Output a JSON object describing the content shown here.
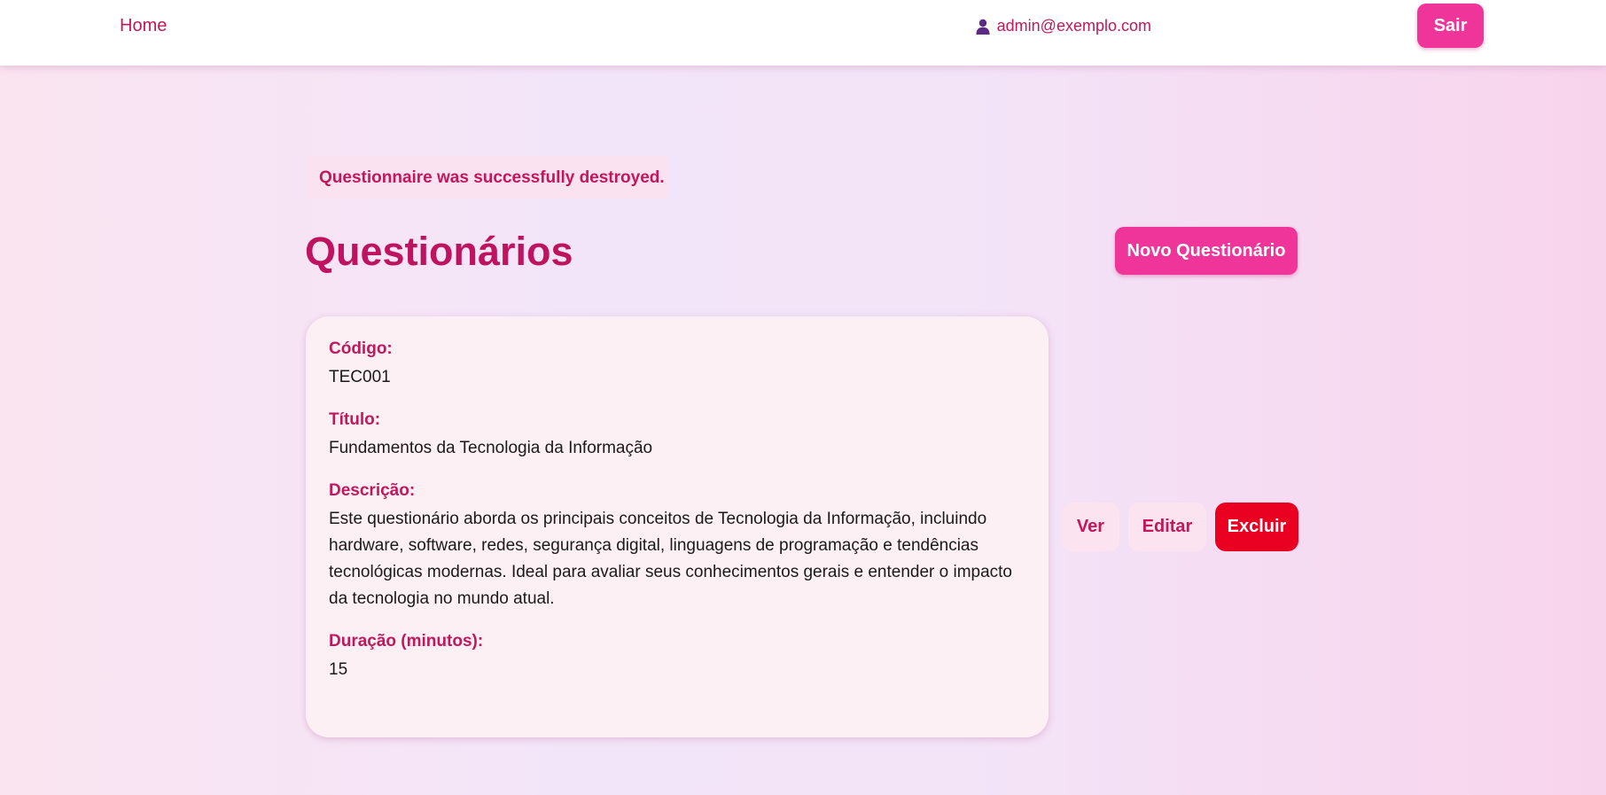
{
  "nav": {
    "home_label": "Home",
    "user_email": "admin@exemplo.com",
    "logout_label": "Sair"
  },
  "notice": "Questionnaire was successfully destroyed.",
  "page": {
    "title": "Questionários",
    "new_button_label": "Novo Questionário"
  },
  "questionnaire": {
    "code_label": "Código:",
    "code_value": "TEC001",
    "title_label": "Título:",
    "title_value": "Fundamentos da Tecnologia da Informação",
    "description_label": "Descrição:",
    "description_value": "Este questionário aborda os principais conceitos de Tecnologia da Informação, incluindo hardware, software, redes, segurança digital, linguagens de programação e tendências tecnológicas modernas. Ideal para avaliar seus conhecimentos gerais e entender o impacto da tecnologia no mundo atual.",
    "duration_label": "Duração (minutos):",
    "duration_value": "15"
  },
  "actions": {
    "view_label": "Ver",
    "edit_label": "Editar",
    "delete_label": "Excluir"
  },
  "colors": {
    "accent": "#f0359a",
    "text_accent": "#c2185b",
    "danger": "#ea0020",
    "user_icon": "#5b2a86"
  },
  "icons": {
    "user": "user-icon"
  }
}
